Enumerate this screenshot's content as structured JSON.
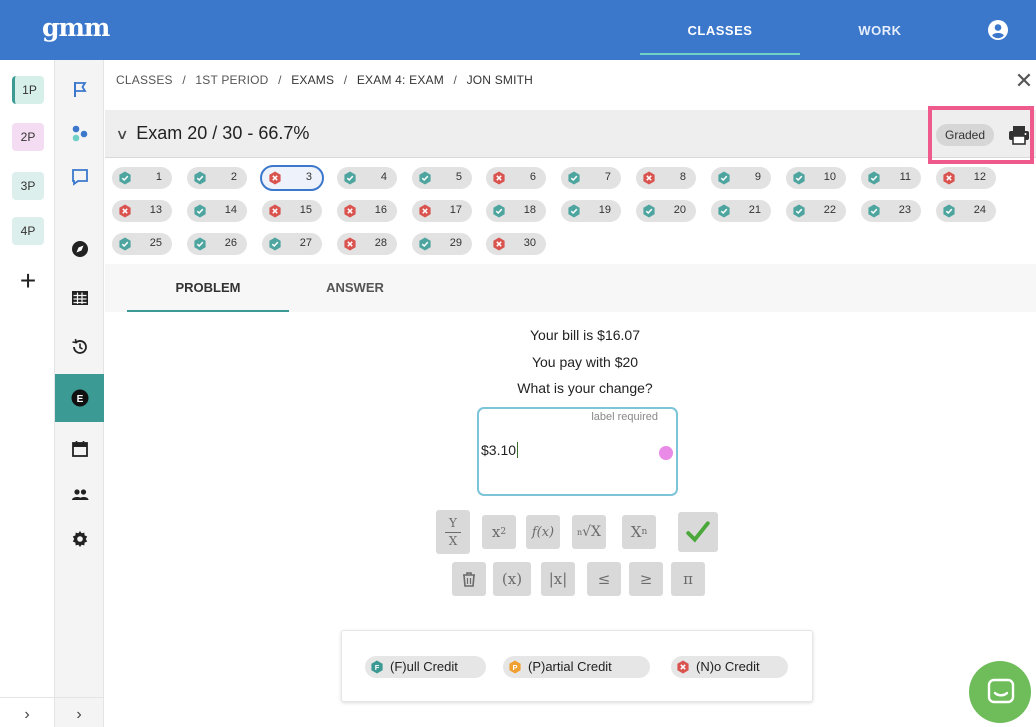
{
  "app": {
    "logo": "gmm"
  },
  "nav": {
    "classes_label": "CLASSES",
    "work_label": "WORK"
  },
  "class_rail": [
    {
      "label": "1P",
      "color": "#d7efe9"
    },
    {
      "label": "2P",
      "color": "#f4dcf2"
    },
    {
      "label": "3P",
      "color": "#dcefec"
    },
    {
      "label": "4P",
      "color": "#dcefec"
    }
  ],
  "tool_rail": [
    "flag-icon",
    "molecule-icon",
    "chat-icon",
    "compass-icon",
    "grid-icon",
    "history-icon",
    "exam-icon",
    "calendar-icon",
    "people-icon",
    "settings-icon"
  ],
  "breadcrumb": {
    "items": [
      "CLASSES",
      "1ST PERIOD",
      "EXAMS",
      "EXAM 4: EXAM",
      "JON SMITH"
    ],
    "separator": "/"
  },
  "exam": {
    "title": "Exam 20 / 30 - 66.7%",
    "status_badge": "Graded"
  },
  "questions": [
    {
      "n": "1",
      "status": "correct"
    },
    {
      "n": "2",
      "status": "correct"
    },
    {
      "n": "3",
      "status": "incorrect",
      "current": true
    },
    {
      "n": "4",
      "status": "correct"
    },
    {
      "n": "5",
      "status": "correct"
    },
    {
      "n": "6",
      "status": "incorrect"
    },
    {
      "n": "7",
      "status": "correct"
    },
    {
      "n": "8",
      "status": "incorrect"
    },
    {
      "n": "9",
      "status": "correct"
    },
    {
      "n": "10",
      "status": "correct"
    },
    {
      "n": "11",
      "status": "correct"
    },
    {
      "n": "12",
      "status": "incorrect"
    },
    {
      "n": "13",
      "status": "incorrect"
    },
    {
      "n": "14",
      "status": "correct"
    },
    {
      "n": "15",
      "status": "incorrect"
    },
    {
      "n": "16",
      "status": "incorrect"
    },
    {
      "n": "17",
      "status": "incorrect"
    },
    {
      "n": "18",
      "status": "correct"
    },
    {
      "n": "19",
      "status": "correct"
    },
    {
      "n": "20",
      "status": "correct"
    },
    {
      "n": "21",
      "status": "correct"
    },
    {
      "n": "22",
      "status": "correct"
    },
    {
      "n": "23",
      "status": "correct"
    },
    {
      "n": "24",
      "status": "correct"
    },
    {
      "n": "25",
      "status": "correct"
    },
    {
      "n": "26",
      "status": "correct"
    },
    {
      "n": "27",
      "status": "correct"
    },
    {
      "n": "28",
      "status": "incorrect"
    },
    {
      "n": "29",
      "status": "correct"
    },
    {
      "n": "30",
      "status": "incorrect"
    }
  ],
  "tabs": {
    "problem": "PROBLEM",
    "answer": "ANSWER"
  },
  "problem": {
    "lines": [
      "Your bill is $16.07",
      "You pay with $20",
      "What is your change?"
    ]
  },
  "answer_box": {
    "hint": "label required",
    "value": "$3.10"
  },
  "keypad": {
    "row1": [
      "fraction",
      "x²",
      "f(x)",
      "root",
      "subscript"
    ],
    "row2": [
      "trash",
      "(x)",
      "|x|",
      "≤",
      "≥",
      "π"
    ]
  },
  "credit": {
    "full": {
      "badge": "F",
      "label": "(F)ull Credit",
      "color": "#3c9a95"
    },
    "partial": {
      "badge": "P",
      "label": "(P)artial Credit",
      "color": "#f0a030"
    },
    "none": {
      "label": "(N)o Credit",
      "color": "#d9534f"
    }
  },
  "colors": {
    "brand": "#3b78cc",
    "accent": "#3c9a95",
    "correct": "#4ea5a0",
    "incorrect": "#d9534f",
    "highlight": "#ef5a8c"
  }
}
